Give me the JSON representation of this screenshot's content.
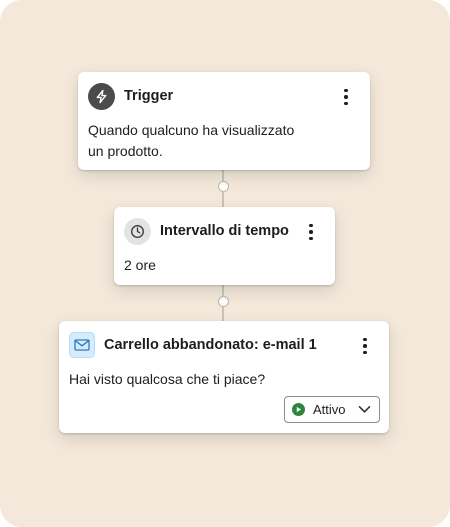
{
  "colors": {
    "background": "#f3e8da",
    "card": "#ffffff",
    "connector": "#c9c2b8",
    "status_active": "#2e8540",
    "mail_icon_bg": "#d6ecfb",
    "mail_icon_stroke": "#2a7bc4"
  },
  "steps": [
    {
      "icon": "lightning-icon",
      "title": "Trigger",
      "body_lines": [
        "Quando qualcuno ha visualizzato",
        "un prodotto."
      ]
    },
    {
      "icon": "clock-icon",
      "title": "Intervallo di tempo",
      "body_lines": [
        "2 ore"
      ]
    },
    {
      "icon": "mail-icon",
      "title": "Carrello abbandonato: e-mail 1",
      "body_lines": [
        "Hai visto qualcosa che ti piace?"
      ],
      "status": {
        "label": "Attivo",
        "icon": "play-icon"
      }
    }
  ]
}
